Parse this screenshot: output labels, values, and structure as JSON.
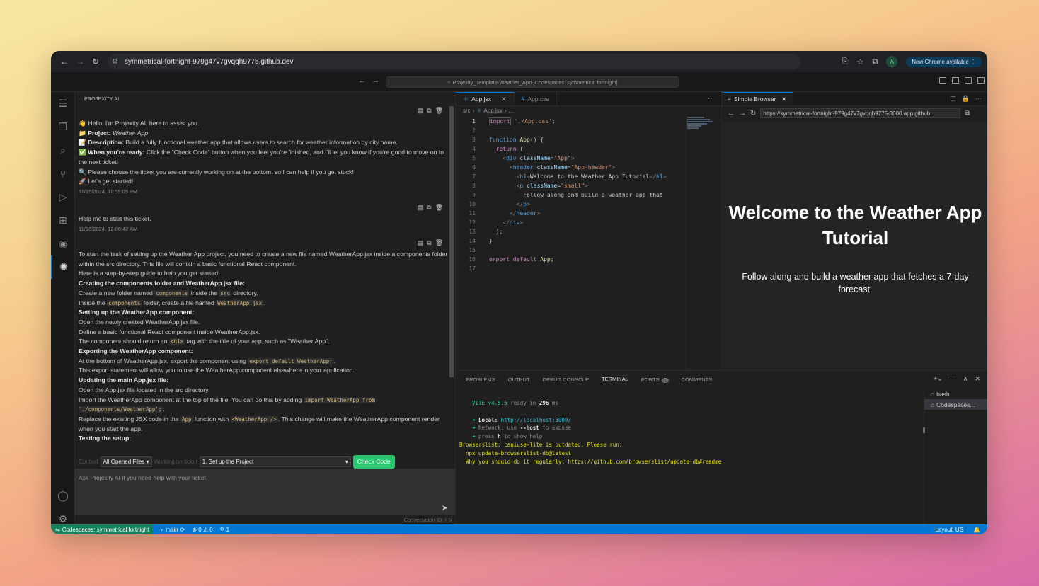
{
  "browser": {
    "url": "symmetrical-fortnight-979g47v7gvqqh9775.github.dev",
    "profile_initial": "A",
    "new_chrome_label": "New Chrome available"
  },
  "vscode": {
    "command_center": "Projexity_Template-Weather_App [Codespaces: symmetrical fortnight]"
  },
  "projexity": {
    "header": "PROJEXITY AI",
    "messages": [
      {
        "lines": [
          "👋 Hello, I'm Projexity AI, here to assist you.",
          "Weather App",
          "Build a fully functional weather app that allows users to search for weather information by city name.",
          "Click the \"Check Code\" button when you feel you're finished, and I'll let you know if you're good to move on to the next ticket!",
          "🔍 Please choose the ticket you are currently working on at the bottom, so I can help if you get stuck!",
          "🚀 Let's get started!"
        ],
        "project_label": "📁 Project:",
        "description_label": "📝 Description:",
        "ready_label": "✅ When you're ready:",
        "time": "11/15/2024, 11:59:09 PM"
      },
      {
        "text": "Help me to start this ticket.",
        "time": "11/16/2024, 12:00:42 AM"
      },
      {
        "intro": "To start the task of setting up the Weather App project, you need to create a new file named WeatherApp.jsx inside a components folder within the src directory. This file will contain a basic functional React component.",
        "guide": "Here is a step-by-step guide to help you get started:",
        "h1": "Creating the components folder and WeatherApp.jsx file:",
        "s1a_pre": "Create a new folder named",
        "s1a_code": "components",
        "s1a_mid": "inside the",
        "s1a_code2": "src",
        "s1a_post": "directory.",
        "s1b_pre": "Inside the",
        "s1b_code": "components",
        "s1b_mid": "folder, create a file named",
        "s1b_code2": "WeatherApp.jsx",
        "s1b_post": ".",
        "h2": "Setting up the WeatherApp component:",
        "s2a": "Open the newly created WeatherApp.jsx file.",
        "s2b": "Define a basic functional React component inside WeatherApp.jsx.",
        "s2c_pre": "The component should return an",
        "s2c_code": "<h1>",
        "s2c_post": "tag with the title of your app, such as \"Weather App\".",
        "h3": "Exporting the WeatherApp component:",
        "s3a_pre": "At the bottom of WeatherApp.jsx, export the component using",
        "s3a_code": "export default WeatherApp;",
        "s3a_post": ".",
        "s3b": "This export statement will allow you to use the WeatherApp component elsewhere in your application.",
        "h4": "Updating the main App.jsx file:",
        "s4a": "Open the App.jsx file located in the src directory.",
        "s4b_pre": "Import the WeatherApp component at the top of the file. You can do this by adding",
        "s4b_code": "import WeatherApp from './components/WeatherApp';",
        "s4b_post": ".",
        "s4c_pre": "Replace the existing JSX code in the",
        "s4c_code": "App",
        "s4c_mid": "function with",
        "s4c_code2": "<WeatherApp />",
        "s4c_post": ". This change will make the WeatherApp component render when you start the app.",
        "h5": "Testing the setup:"
      }
    ],
    "context_label": "Context",
    "context_value": "All Opened Files",
    "ticket_label": "Working on ticket",
    "ticket_value": "1. Set up the Project",
    "check_label": "Check Code",
    "ask_placeholder": "Ask Projexity AI if you need help with your ticket.",
    "conversation_id": "Conversation ID: /"
  },
  "editor": {
    "tabs": [
      {
        "label": "App.jsx",
        "active": true
      },
      {
        "label": "App.css",
        "active": false
      }
    ],
    "breadcrumb": [
      "src",
      "App.jsx",
      "..."
    ],
    "line_numbers": [
      "1",
      "2",
      "3",
      "4",
      "5",
      "6",
      "7",
      "8",
      "9",
      "10",
      "11",
      "12",
      "13",
      "14",
      "15",
      "16",
      "17"
    ]
  },
  "simple_browser": {
    "tab_label": "Simple Browser",
    "url": "https://symmetrical-fortnight-979g47v7gvqqh9775-3000.app.github.",
    "heading": "Welcome to the Weather App Tutorial",
    "paragraph": "Follow along and build a weather app that fetches a 7-day forecast."
  },
  "panel": {
    "tabs": [
      "PROBLEMS",
      "OUTPUT",
      "DEBUG CONSOLE",
      "TERMINAL",
      "PORTS",
      "COMMENTS"
    ],
    "ports_count": "1",
    "terminal": {
      "vite": "VITE v4.5.5",
      "ready": "ready in",
      "ready_ms": "296",
      "ms": "ms",
      "local_label": "Local:",
      "local_url": "http://localhost:3000/",
      "network_label": "Network:",
      "network_text": "use",
      "network_flag": "--host",
      "network_tail": "to expose",
      "help_pre": "press",
      "help_key": "h",
      "help_post": "to show help",
      "warn1": "Browserslist: caniuse-lite is outdated. Please run:",
      "warn2": "npx update-browserslist-db@latest",
      "warn3": "Why you should do it regularly: https://github.com/browserslist/update-db#readme"
    },
    "terminals": [
      "bash",
      "Codespaces..."
    ]
  },
  "status": {
    "remote": "Codespaces: symmetrical fortnight",
    "branch": "main",
    "problems": "⊗ 0 ⚠ 0",
    "ports": "1",
    "layout": "Layout: US"
  }
}
